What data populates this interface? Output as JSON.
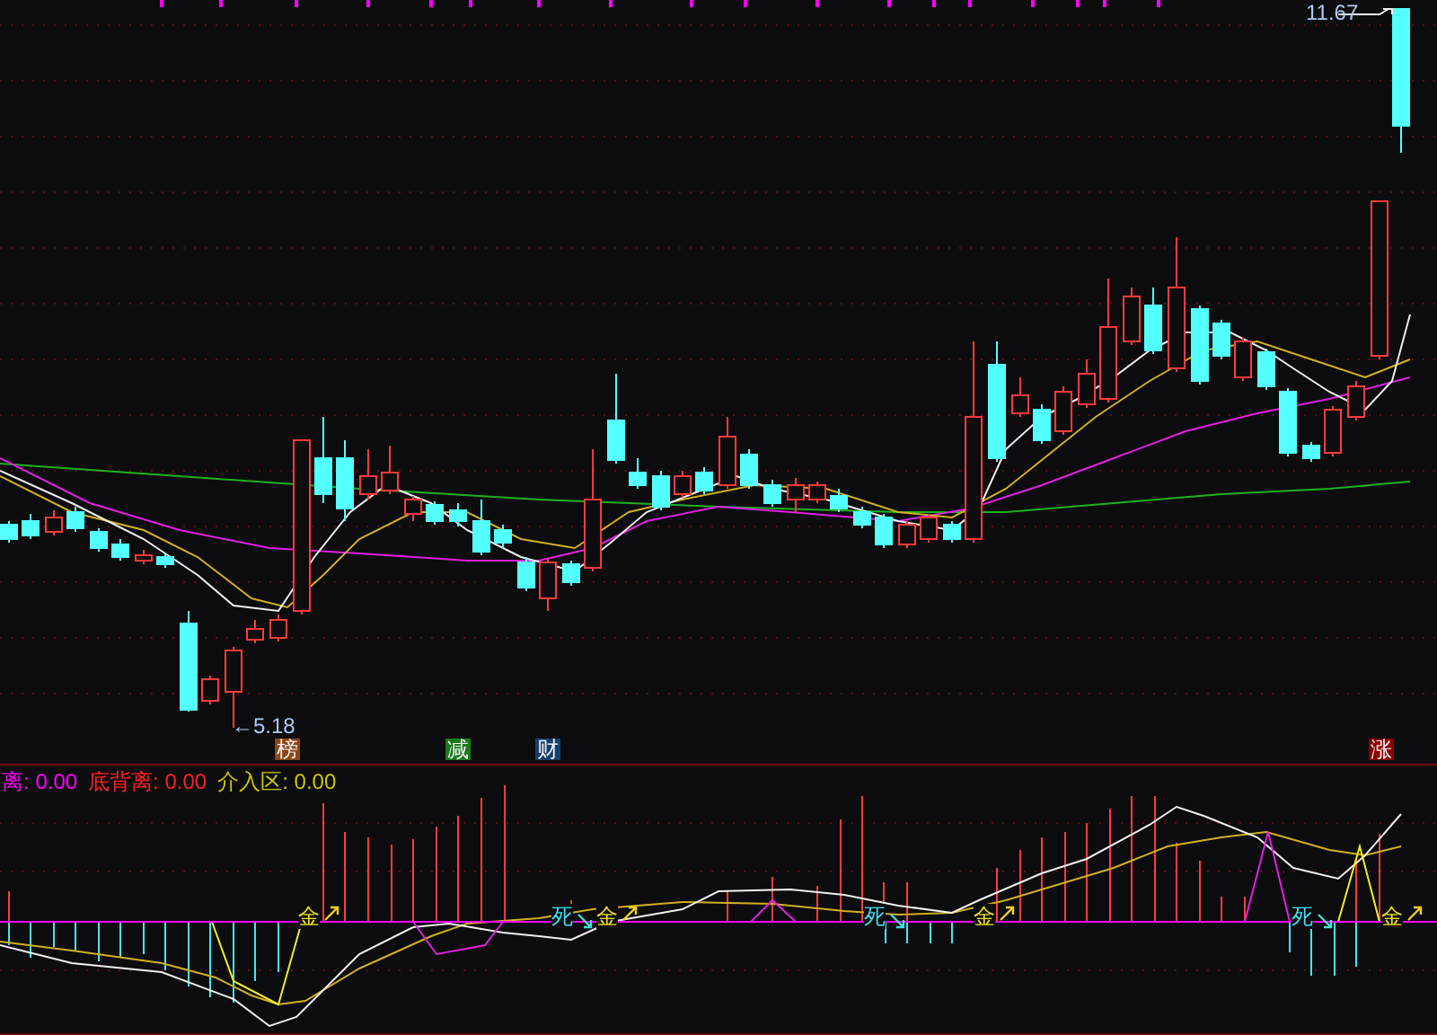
{
  "price_chart": {
    "high_label": "11.67",
    "low_label": "←5.18",
    "event_tags": [
      {
        "text": "榜",
        "color": "#8b4513"
      },
      {
        "text": "减",
        "color": "#1a7a1a"
      },
      {
        "text": "财",
        "color": "#173f6e"
      },
      {
        "text": "涨",
        "color": "#8b0000"
      }
    ]
  },
  "indicator": {
    "readings": [
      {
        "label": "离:",
        "value": "0.00",
        "color": "#ff00ff"
      },
      {
        "label": "底背离:",
        "value": "0.00",
        "color": "#ff2020"
      },
      {
        "label": "介入区:",
        "value": "0.00",
        "color": "#c8c800"
      }
    ],
    "signals": [
      {
        "text": "金",
        "kind": "golden"
      },
      {
        "text": "死",
        "kind": "death"
      },
      {
        "text": "金",
        "kind": "golden"
      },
      {
        "text": "死",
        "kind": "death"
      },
      {
        "text": "金",
        "kind": "golden"
      },
      {
        "text": "死",
        "kind": "death"
      },
      {
        "text": "金",
        "kind": "golden"
      }
    ]
  }
}
